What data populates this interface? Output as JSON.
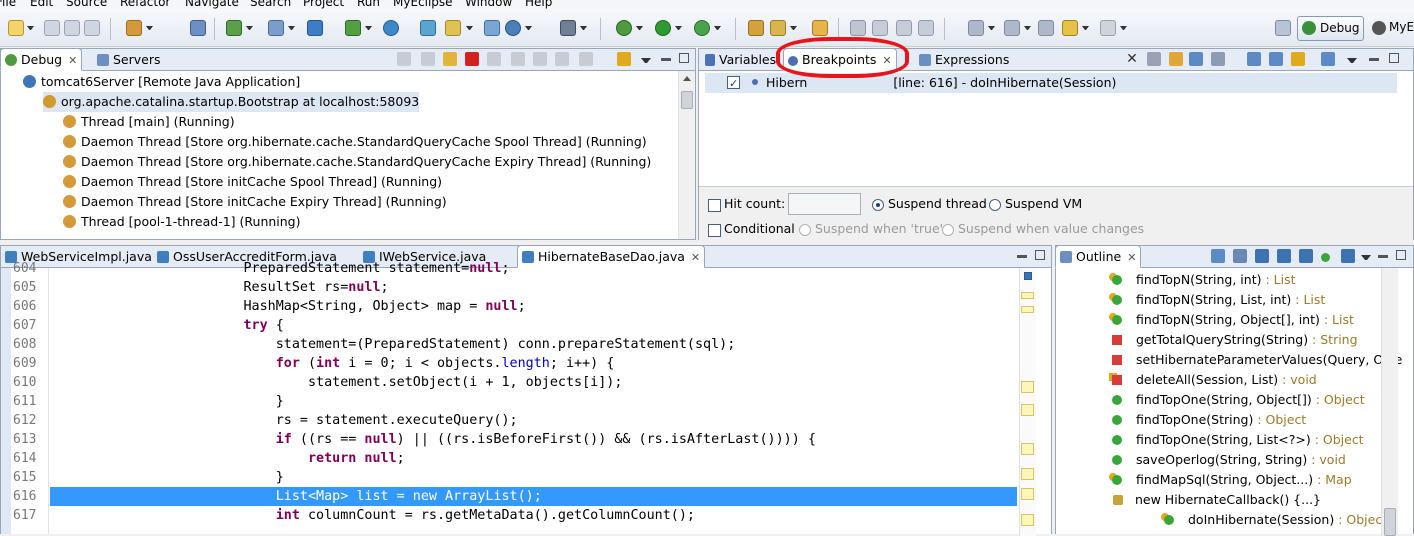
{
  "menubar": [
    "File",
    "Edit",
    "Source",
    "Refactor",
    "Navigate",
    "Search",
    "Project",
    "Run",
    "MyEclipse",
    "Window",
    "Help"
  ],
  "perspectives": {
    "debug": "Debug",
    "myeclipse": "MyE"
  },
  "debug_view": {
    "tabs": [
      {
        "label": "Debug",
        "active": true
      },
      {
        "label": "Servers",
        "active": false
      }
    ],
    "tree": [
      {
        "label": "tomcat6Server [Remote Java Application]",
        "level": 0,
        "icon": "remote-app-icon"
      },
      {
        "label": "org.apache.catalina.startup.Bootstrap at localhost:58093",
        "level": 1,
        "icon": "debug-target-icon",
        "selected": true
      },
      {
        "label": "Thread [main] (Running)",
        "level": 2,
        "icon": "thread-running-icon"
      },
      {
        "label": "Daemon Thread [Store org.hibernate.cache.StandardQueryCache Spool Thread] (Running)",
        "level": 2,
        "icon": "thread-running-icon"
      },
      {
        "label": "Daemon Thread [Store org.hibernate.cache.StandardQueryCache Expiry Thread] (Running)",
        "level": 2,
        "icon": "thread-running-icon"
      },
      {
        "label": "Daemon Thread [Store initCache Spool Thread] (Running)",
        "level": 2,
        "icon": "thread-running-icon"
      },
      {
        "label": "Daemon Thread [Store initCache Expiry Thread] (Running)",
        "level": 2,
        "icon": "thread-running-icon"
      },
      {
        "label": "Thread [pool-1-thread-1] (Running)",
        "level": 2,
        "icon": "thread-running-icon"
      }
    ]
  },
  "breakpoints_view": {
    "tabs": [
      {
        "label": "Variables",
        "active": false
      },
      {
        "label": "Breakpoints",
        "active": true
      },
      {
        "label": "Expressions",
        "active": false
      }
    ],
    "entry": {
      "checked": true,
      "label_start": "Hibern",
      "label_end": "[line: 616] - doInHibernate(Session)"
    },
    "hit_count_label": "Hit count:",
    "hit_count_value": "",
    "suspend_thread": "Suspend thread",
    "suspend_vm": "Suspend VM",
    "conditional": "Conditional",
    "suspend_true": "Suspend when 'true'",
    "suspend_changes": "Suspend when value changes"
  },
  "editor": {
    "tabs": [
      {
        "label": "WebServiceImpl.java",
        "active": false
      },
      {
        "label": "OssUserAccreditForm.java",
        "active": false
      },
      {
        "label": "IWebService.java",
        "active": false
      },
      {
        "label": "HibernateBaseDao.java",
        "active": true
      }
    ],
    "lines": [
      {
        "num": "604",
        "text": "                        PreparedStatement statement=null;",
        "highlight": false
      },
      {
        "num": "605",
        "text": "                        ResultSet rs=null;",
        "highlight": false
      },
      {
        "num": "606",
        "text": "                        HashMap<String, Object> map = null;",
        "highlight": false
      },
      {
        "num": "607",
        "text": "                        try {",
        "highlight": false
      },
      {
        "num": "608",
        "text": "                            statement=(PreparedStatement) conn.prepareStatement(sql);",
        "highlight": false
      },
      {
        "num": "609",
        "text": "                            for (int i = 0; i < objects.length; i++) {",
        "highlight": false
      },
      {
        "num": "610",
        "text": "                                statement.setObject(i + 1, objects[i]);",
        "highlight": false
      },
      {
        "num": "611",
        "text": "                            }",
        "highlight": false
      },
      {
        "num": "612",
        "text": "                            rs = statement.executeQuery();",
        "highlight": false
      },
      {
        "num": "613",
        "text": "                            if ((rs == null) || ((rs.isBeforeFirst()) && (rs.isAfterLast()))) {",
        "highlight": false
      },
      {
        "num": "614",
        "text": "                                return null;",
        "highlight": false
      },
      {
        "num": "615",
        "text": "                            }",
        "highlight": false
      },
      {
        "num": "616",
        "text": "                            List<Map> list = new ArrayList();",
        "highlight": true
      },
      {
        "num": "617",
        "text": "                            int columnCount = rs.getMetaData().getColumnCount();",
        "highlight": false
      }
    ]
  },
  "outline_view": {
    "tab": "Outline",
    "items": [
      {
        "name": "findTopN(String, int)",
        "type": " : List",
        "icon": "public-override",
        "level": 0
      },
      {
        "name": "findTopN(String, List, int)",
        "type": " : List",
        "icon": "public-override",
        "level": 0
      },
      {
        "name": "findTopN(String, Object[], int)",
        "type": " : List",
        "icon": "public-override",
        "level": 0
      },
      {
        "name": "getTotalQueryString(String)",
        "type": " : String",
        "icon": "private",
        "level": 0
      },
      {
        "name": "setHibernateParameterValues(Query, Obje",
        "type": "",
        "icon": "private",
        "level": 0
      },
      {
        "name": "deleteAll(Session, List)",
        "type": " : void",
        "icon": "private-override",
        "level": 0
      },
      {
        "name": "findTopOne(String, Object[])",
        "type": " : Object",
        "icon": "public",
        "level": 0
      },
      {
        "name": "findTopOne(String)",
        "type": " : Object",
        "icon": "public",
        "level": 0
      },
      {
        "name": "findTopOne(String, List<?>)",
        "type": " : Object",
        "icon": "public",
        "level": 0
      },
      {
        "name": "saveOperlog(String, String)",
        "type": " : void",
        "icon": "public",
        "level": 0
      },
      {
        "name": "findMapSql(String, Object...)",
        "type": " : Map",
        "icon": "public-override",
        "level": 0
      },
      {
        "name": "new HibernateCallback() {...}",
        "type": "",
        "icon": "anonymous-class",
        "level": 1
      },
      {
        "name": "doInHibernate(Session)",
        "type": " : Object",
        "icon": "public-override",
        "level": 2
      }
    ]
  },
  "colors": {
    "selection": "#3399ff",
    "keyword": "#7f0055",
    "field": "#0000c0",
    "annotation": "#e8141b"
  }
}
